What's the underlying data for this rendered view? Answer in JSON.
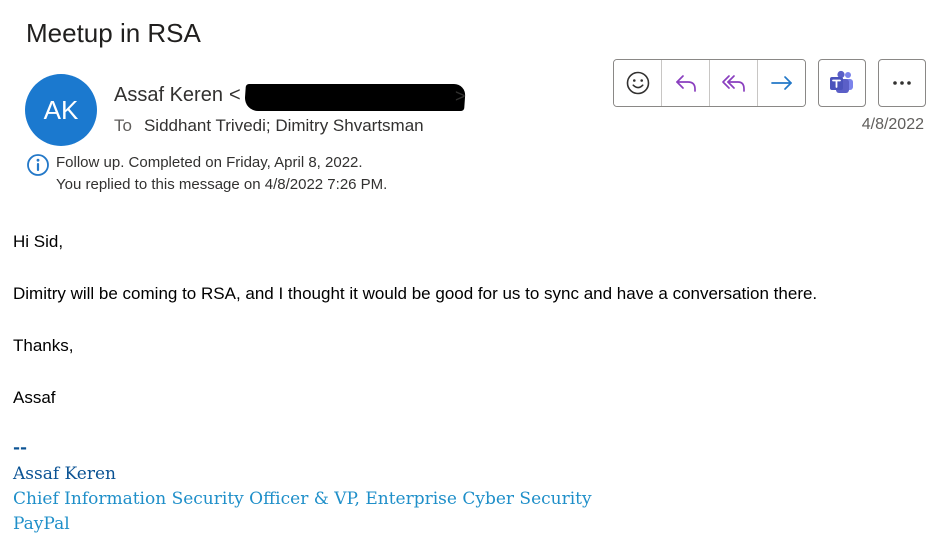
{
  "subject": "Meetup in RSA",
  "sender": {
    "initials": "AK",
    "name": "Assaf Keren",
    "email_open": "<",
    "email_close": ">"
  },
  "recipients": {
    "label": "To",
    "names": "Siddhant Trivedi; Dimitry Shvartsman"
  },
  "date": "4/8/2022",
  "toolbar": {
    "icons": [
      "emoji-icon",
      "reply-icon",
      "reply-all-icon",
      "forward-icon",
      "teams-icon",
      "more-icon"
    ]
  },
  "info": {
    "line1": "Follow up.  Completed on Friday, April 8, 2022.",
    "line2": "You replied to this message on 4/8/2022 7:26 PM."
  },
  "body": {
    "greeting": "Hi Sid,",
    "paragraph": "Dimitry will be coming to RSA, and I thought it would be good for us to sync and have a conversation there.",
    "thanks": "Thanks,",
    "name": "Assaf"
  },
  "signature": {
    "dashes": "--",
    "name": "Assaf Keren",
    "title": "Chief Information Security Officer & VP, Enterprise Cyber Security",
    "company": "PayPal"
  },
  "colors": {
    "avatar": "#1b79cf",
    "reply_purple": "#8a3fbf",
    "forward_blue": "#2378c8",
    "teams": "#5b5fc7",
    "signature_dark": "#0b5394",
    "signature_light": "#1f8fc9"
  }
}
